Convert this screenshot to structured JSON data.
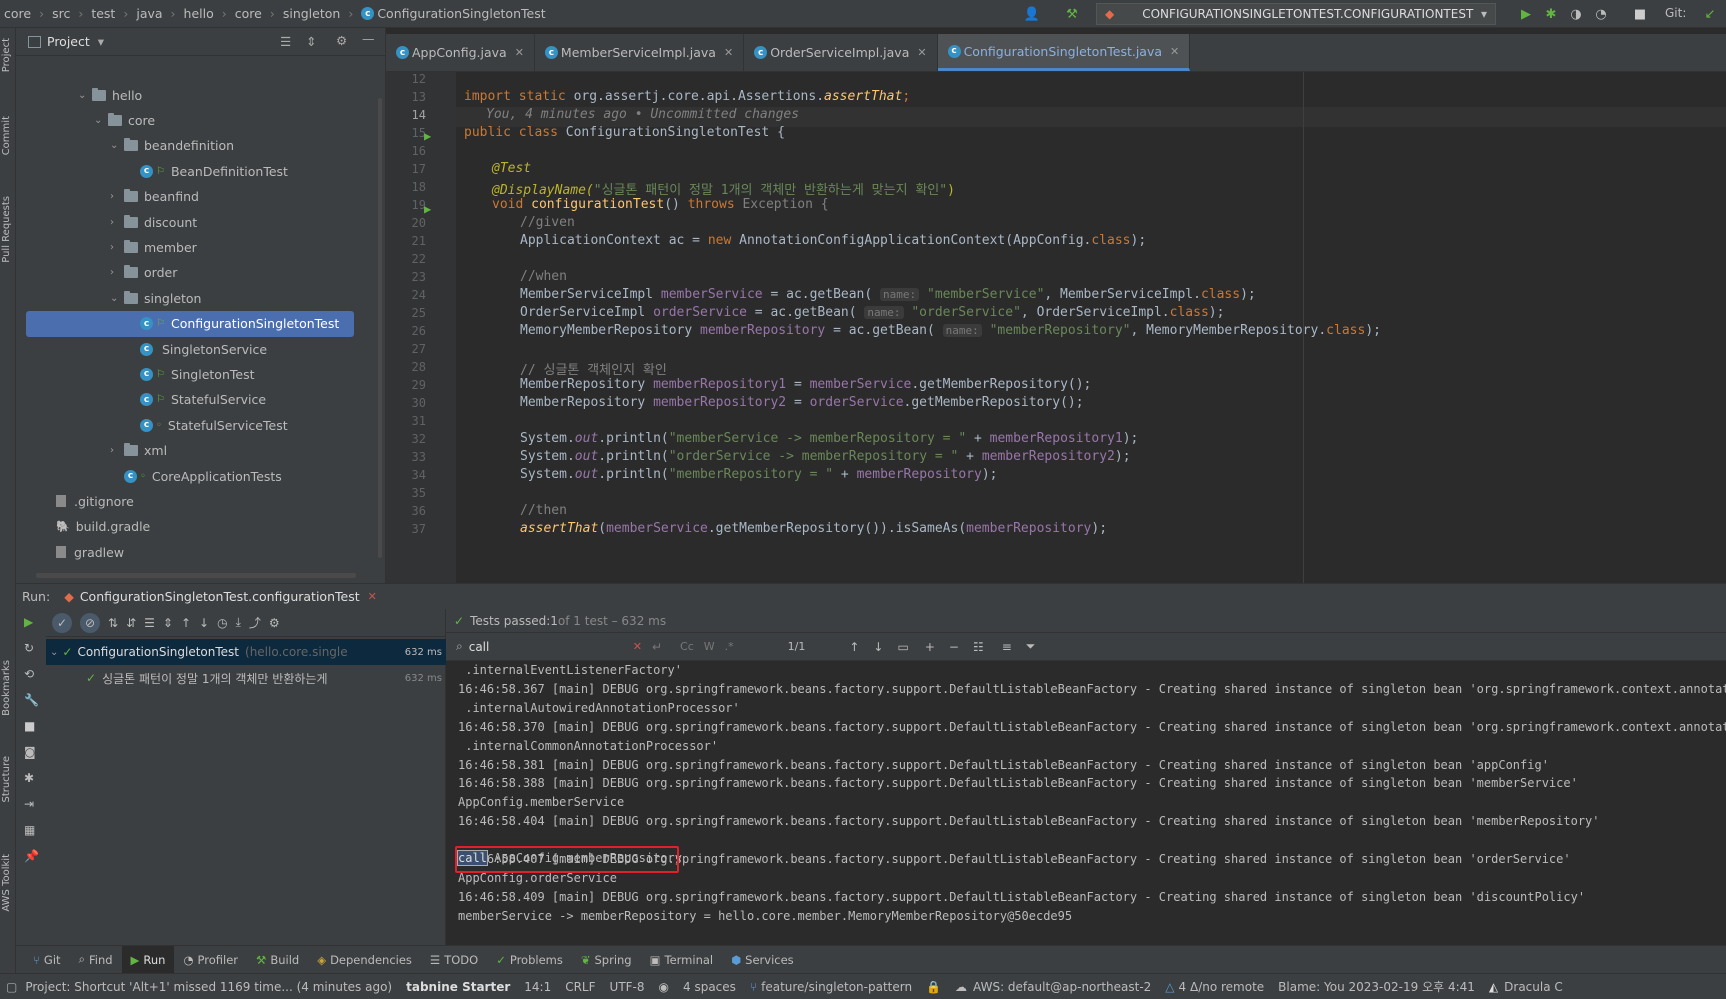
{
  "breadcrumb": [
    "core",
    "src",
    "test",
    "java",
    "hello",
    "core",
    "singleton",
    "ConfigurationSingletonTest"
  ],
  "run_config": "CONFIGURATIONSINGLETONTEST.CONFIGURATIONTEST",
  "git_label": "Git:",
  "project": {
    "title": "Project",
    "tree": [
      {
        "label": "hello",
        "indent": 0,
        "arrow": "open",
        "type": "folder"
      },
      {
        "label": "core",
        "indent": 1,
        "arrow": "open",
        "type": "folder"
      },
      {
        "label": "beandefinition",
        "indent": 2,
        "arrow": "open",
        "type": "folder"
      },
      {
        "label": "BeanDefinitionTest",
        "indent": 3,
        "arrow": "",
        "type": "test"
      },
      {
        "label": "beanfind",
        "indent": 2,
        "arrow": "closed",
        "type": "folder"
      },
      {
        "label": "discount",
        "indent": 2,
        "arrow": "closed",
        "type": "folder"
      },
      {
        "label": "member",
        "indent": 2,
        "arrow": "closed",
        "type": "folder"
      },
      {
        "label": "order",
        "indent": 2,
        "arrow": "closed",
        "type": "folder"
      },
      {
        "label": "singleton",
        "indent": 2,
        "arrow": "open",
        "type": "folder"
      },
      {
        "label": "ConfigurationSingletonTest",
        "indent": 3,
        "arrow": "",
        "type": "test",
        "selected": true
      },
      {
        "label": "SingletonService",
        "indent": 3,
        "arrow": "",
        "type": "class"
      },
      {
        "label": "SingletonTest",
        "indent": 3,
        "arrow": "",
        "type": "test"
      },
      {
        "label": "StatefulService",
        "indent": 3,
        "arrow": "",
        "type": "test"
      },
      {
        "label": "StatefulServiceTest",
        "indent": 3,
        "arrow": "",
        "type": "test2"
      },
      {
        "label": "xml",
        "indent": 2,
        "arrow": "closed",
        "type": "folder"
      },
      {
        "label": "CoreApplicationTests",
        "indent": 2,
        "arrow": "",
        "type": "test2"
      },
      {
        "label": ".gitignore",
        "indent": -1,
        "arrow": "",
        "type": "file"
      },
      {
        "label": "build.gradle",
        "indent": -1,
        "arrow": "",
        "type": "gradle"
      },
      {
        "label": "gradlew",
        "indent": -1,
        "arrow": "",
        "type": "file"
      }
    ]
  },
  "tabs": [
    {
      "label": "AppConfig.java",
      "active": false
    },
    {
      "label": "MemberServiceImpl.java",
      "active": false
    },
    {
      "label": "OrderServiceImpl.java",
      "active": false
    },
    {
      "label": "ConfigurationSingletonTest.java",
      "active": true
    }
  ],
  "editor": {
    "line_numbers": [
      "12",
      "13",
      "14",
      "15",
      "16",
      "17",
      "18",
      "19",
      "20",
      "21",
      "22",
      "23",
      "24",
      "25",
      "26",
      "27",
      "28",
      "29",
      "30",
      "31",
      "32",
      "33",
      "34",
      "35",
      "36",
      "37"
    ],
    "blame": "You, 4 minutes ago • Uncommitted changes",
    "l13a": "import static ",
    "l13b": "org.assertj.core.api.Assertions.",
    "l13c": "assertThat",
    "l15a": "public class ",
    "l15b": "ConfigurationSingletonTest {",
    "l17": "@Test",
    "l18a": "@DisplayName(",
    "l18b": "\"싱글톤 패턴이 정말 1개의 객체만 반환하는게 맞는지 확인\"",
    "l18c": ")",
    "l19a": "void ",
    "l19b": "configurationTest",
    "l19c": "() ",
    "l19d": "throws ",
    "l19e": "Exception {",
    "l20": "//given",
    "l21a": "ApplicationContext ac = ",
    "l21b": "new ",
    "l21c": "AnnotationConfigApplicationContext(AppConfig.",
    "l21d": "class",
    "l23": "//when",
    "l24a": "MemberServiceImpl ",
    "l24b": "memberService",
    "l24c": " = ac.getBean( ",
    "l24d": "name:",
    "l24e": "\"memberService\"",
    "l24f": ", MemberServiceImpl.",
    "l24g": "class",
    "l25a": "OrderServiceImpl ",
    "l25b": "orderService",
    "l25c": " = ac.getBean( ",
    "l25d": "name:",
    "l25e": "\"orderService\"",
    "l25f": ", OrderServiceImpl.",
    "l25g": "class",
    "l26a": "MemoryMemberRepository ",
    "l26b": "memberRepository",
    "l26c": " = ac.getBean( ",
    "l26d": "name:",
    "l26e": "\"memberRepository\"",
    "l26f": ", MemoryMemberRepository.",
    "l26g": "class",
    "l28": "// 싱글톤 객체인지 확인",
    "l29a": "MemberRepository ",
    "l29b": "memberRepository1",
    "l29c": " = ",
    "l29d": "memberService",
    ".": "",
    "l29e": ".getMemberRepository();",
    "l30a": "MemberRepository ",
    "l30b": "memberRepository2",
    "l30c": " = ",
    "l30d": "orderService",
    "l30e": ".getMemberRepository();",
    "l32a": "System.",
    "l32b": "out",
    "l32c": ".println(",
    "l32d": "\"memberService -> memberRepository = \"",
    "l32e": " + ",
    "l32f": "memberRepository1",
    "l32g": ");",
    "l33a": "System.",
    "l33b": "out",
    "l33c": ".println(",
    "l33d": "\"orderService -> memberRepository = \"",
    "l33e": " + ",
    "l33f": "memberRepository2",
    "l33g": ");",
    "l34a": "System.",
    "l34b": "out",
    "l34c": ".println(",
    "l34d": "\"memberRepository = \"",
    "l34e": " + ",
    "l34f": "memberRepository",
    "l34g": ");",
    "l36": "//then",
    "l37a": "assertThat",
    "l37b": "(",
    "l37c": "memberService",
    "l37d": ".getMemberRepository()).isSameAs(",
    "l37e": "memberRepository",
    "l37f": ");"
  },
  "run": {
    "label": "Run:",
    "tab": "ConfigurationSingletonTest.configurationTest",
    "status_a": "Tests passed: ",
    "status_b": "1",
    "status_c": " of 1 test – 632 ms",
    "search_value": "call",
    "match_count": "1/1",
    "test_root": "ConfigurationSingletonTest",
    "test_root_pkg": "(hello.core.single",
    "test_root_time": "632 ms",
    "test_child": "싱글톤 패턴이 정말 1개의 객체만 반환하는게",
    "test_child_time": "632 ms",
    "console": [
      " .internalEventListenerFactory'",
      "16:46:58.367 [main] DEBUG org.springframework.beans.factory.support.DefaultListableBeanFactory - Creating shared instance of singleton bean 'org.springframework.context.annotation",
      " .internalAutowiredAnnotationProcessor'",
      "16:46:58.370 [main] DEBUG org.springframework.beans.factory.support.DefaultListableBeanFactory - Creating shared instance of singleton bean 'org.springframework.context.annotation",
      " .internalCommonAnnotationProcessor'",
      "16:46:58.381 [main] DEBUG org.springframework.beans.factory.support.DefaultListableBeanFactory - Creating shared instance of singleton bean 'appConfig'",
      "16:46:58.388 [main] DEBUG org.springframework.beans.factory.support.DefaultListableBeanFactory - Creating shared instance of singleton bean 'memberService'",
      "AppConfig.memberService",
      "16:46:58.404 [main] DEBUG org.springframework.beans.factory.support.DefaultListableBeanFactory - Creating shared instance of singleton bean 'memberRepository'",
      "",
      "16:46:58.407 [main] DEBUG org.springframework.beans.factory.support.DefaultListableBeanFactory - Creating shared instance of singleton bean 'orderService'",
      "AppConfig.orderService",
      "16:46:58.409 [main] DEBUG org.springframework.beans.factory.support.DefaultListableBeanFactory - Creating shared instance of singleton bean 'discountPolicy'",
      "memberService -> memberRepository = hello.core.member.MemoryMemberRepository@50ecde95"
    ],
    "call_highlight": "call",
    "call_rest": " AppConfig.memberRepository"
  },
  "bottom_tabs": [
    "Git",
    "Find",
    "Run",
    "Profiler",
    "Build",
    "Dependencies",
    "TODO",
    "Problems",
    "Spring",
    "Terminal",
    "Services"
  ],
  "left_labels": [
    "Project",
    "Commit",
    "Pull Requests",
    "Bookmarks",
    "Structure",
    "AWS Toolkit"
  ],
  "status": {
    "message": "Project: Shortcut 'Alt+1' missed 1169 time... (4 minutes ago)",
    "tabnine": "tabnine Starter",
    "pos": "14:1",
    "crlf": "CRLF",
    "enc": "UTF-8",
    "indent": "4 spaces",
    "branch": "feature/singleton-pattern",
    "aws": "AWS: default@ap-northeast-2",
    "remote": "4 Δ/no remote",
    "blame": "Blame: You 2023-02-19 오후 4:41",
    "theme": "Dracula C"
  }
}
